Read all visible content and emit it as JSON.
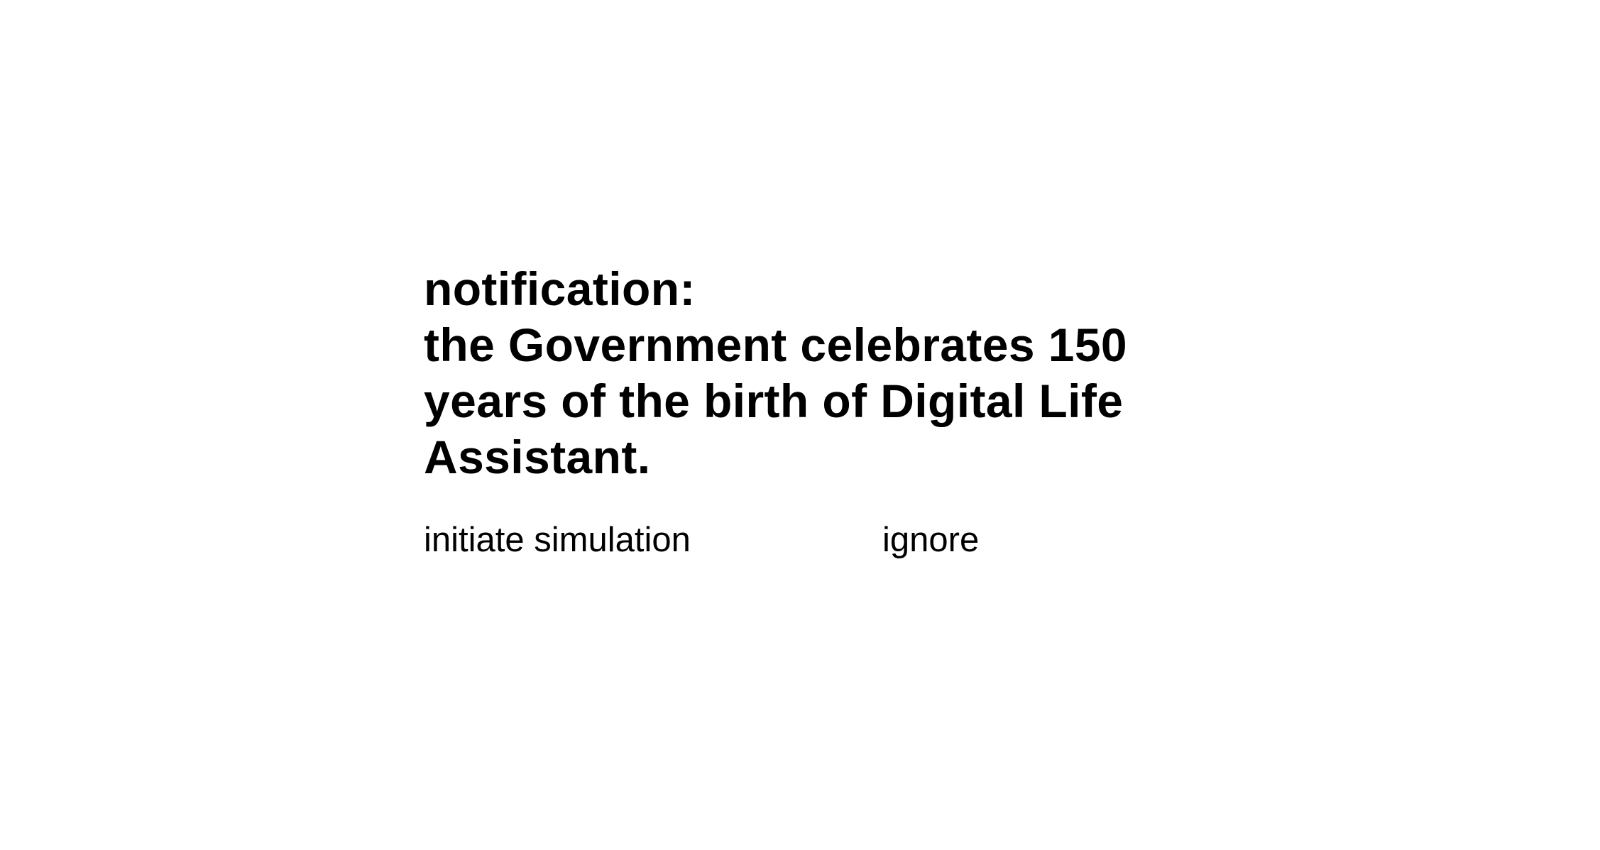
{
  "notification": {
    "lines": [
      "notification:",
      "the Government celebrates 150",
      "years of the birth of Digital Life",
      "Assistant."
    ]
  },
  "actions": {
    "primary_label": "initiate simulation",
    "secondary_label": "ignore"
  },
  "colors": {
    "background": "#ffffff",
    "text": "#000000"
  }
}
